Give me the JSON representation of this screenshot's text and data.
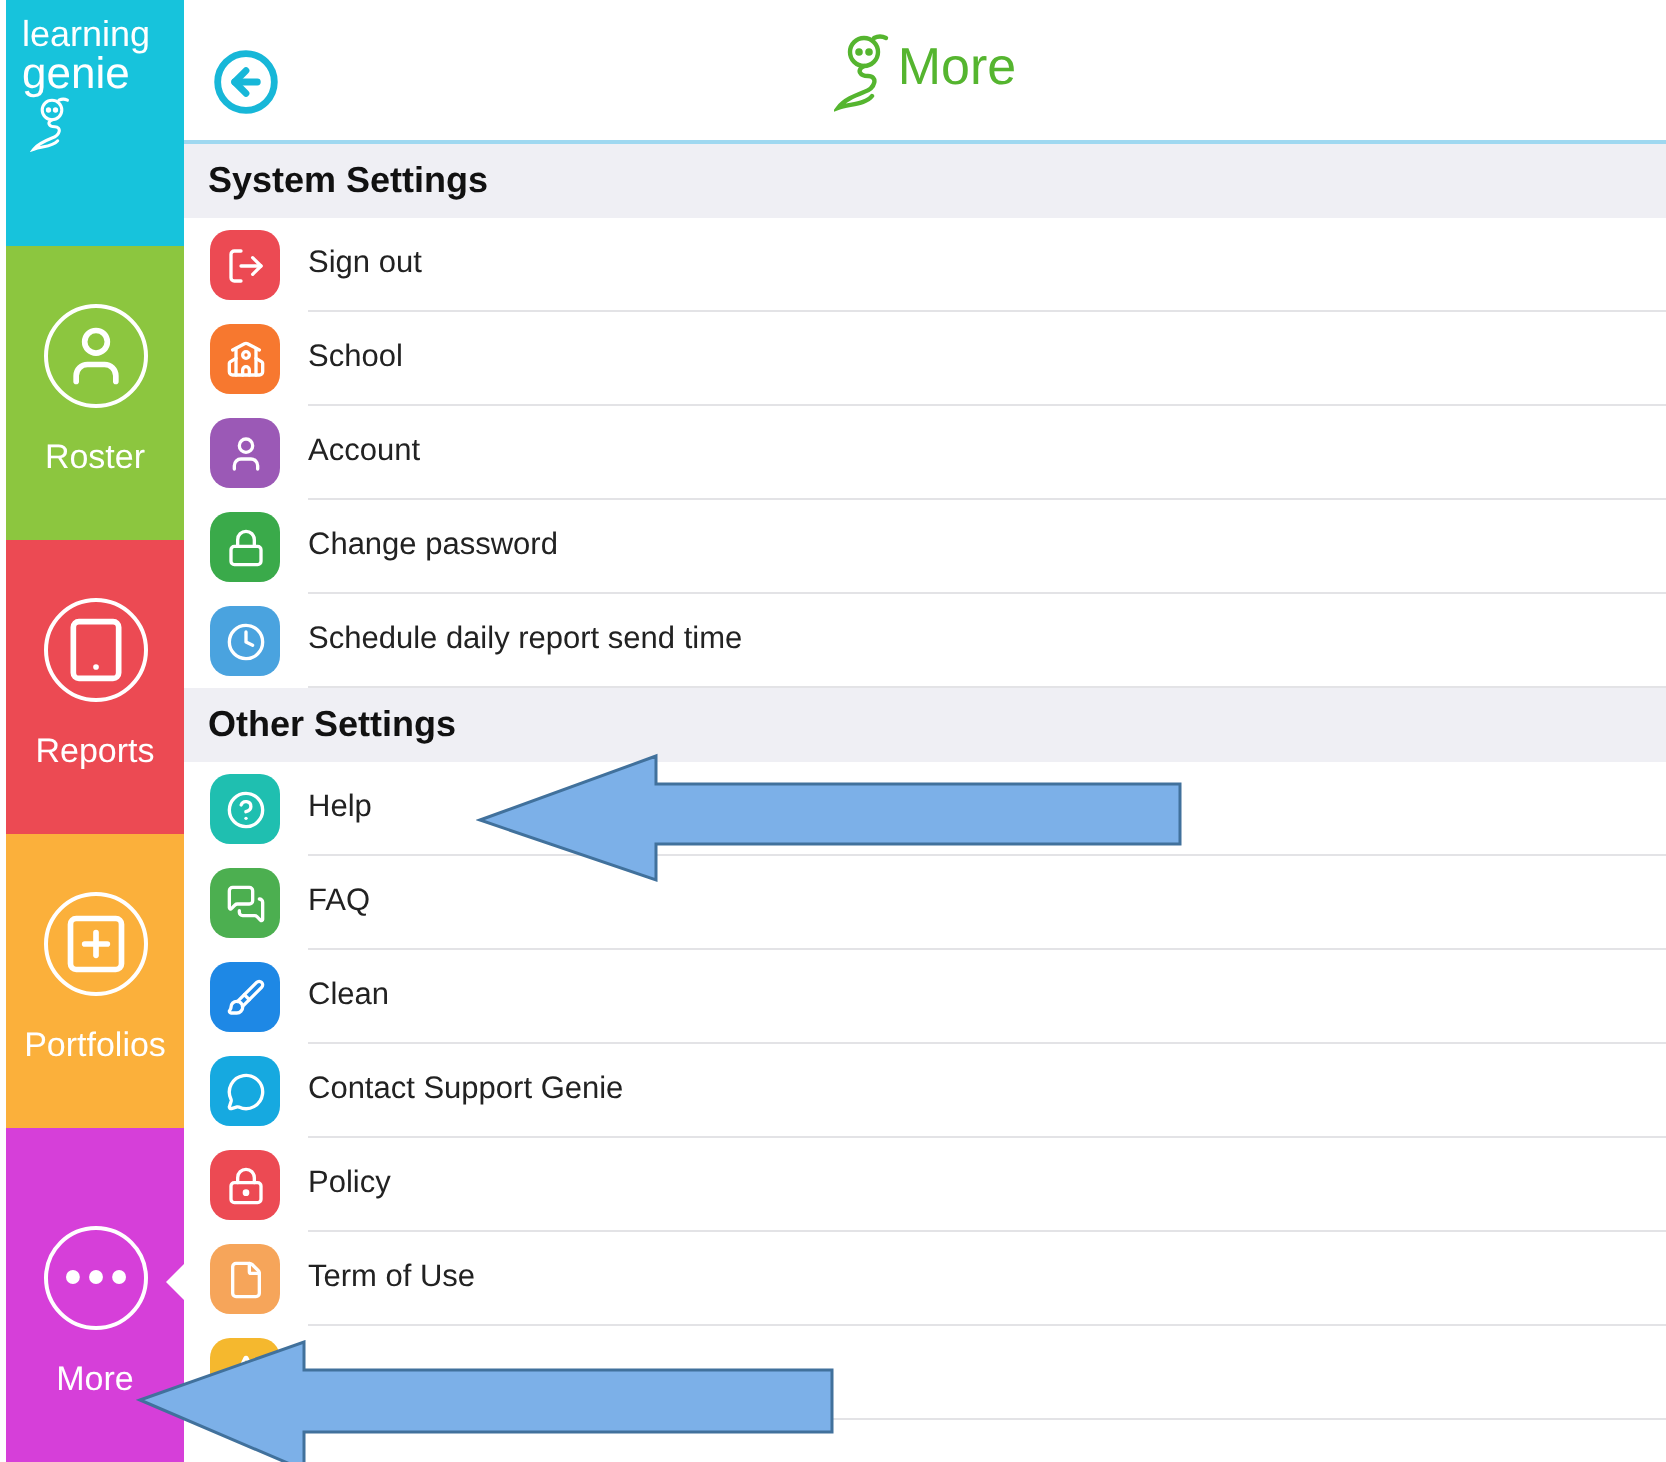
{
  "sidebar": {
    "logo": {
      "line_1": "learning",
      "line_2": "genie"
    },
    "items": [
      {
        "label": "Roster",
        "color": "#8cc63f",
        "selected": false
      },
      {
        "label": "Reports",
        "color": "#ec4a53",
        "selected": false
      },
      {
        "label": "Portfolios",
        "color": "#fbb03b",
        "selected": false
      },
      {
        "label": "More",
        "color": "#d63fd9",
        "selected": true
      }
    ]
  },
  "header": {
    "title": "More"
  },
  "sections": [
    {
      "title": "System Settings",
      "items": [
        {
          "label": "Sign out",
          "color": "#ec4a53"
        },
        {
          "label": "School",
          "color": "#f7782f"
        },
        {
          "label": "Account",
          "color": "#9b59b6"
        },
        {
          "label": "Change password",
          "color": "#3aaa4a"
        },
        {
          "label": "Schedule daily report send time",
          "color": "#4aa3df"
        }
      ]
    },
    {
      "title": "Other Settings",
      "items": [
        {
          "label": "Help",
          "color": "#1fbfb0"
        },
        {
          "label": "FAQ",
          "color": "#4caf50"
        },
        {
          "label": "Clean",
          "color": "#1e88e5"
        },
        {
          "label": "Contact Support Genie",
          "color": "#16a9e0"
        },
        {
          "label": "Policy",
          "color": "#ec4a53"
        },
        {
          "label": "Term of Use",
          "color": "#f6a55a"
        },
        {
          "color": "#f5b82e"
        }
      ]
    }
  ]
}
